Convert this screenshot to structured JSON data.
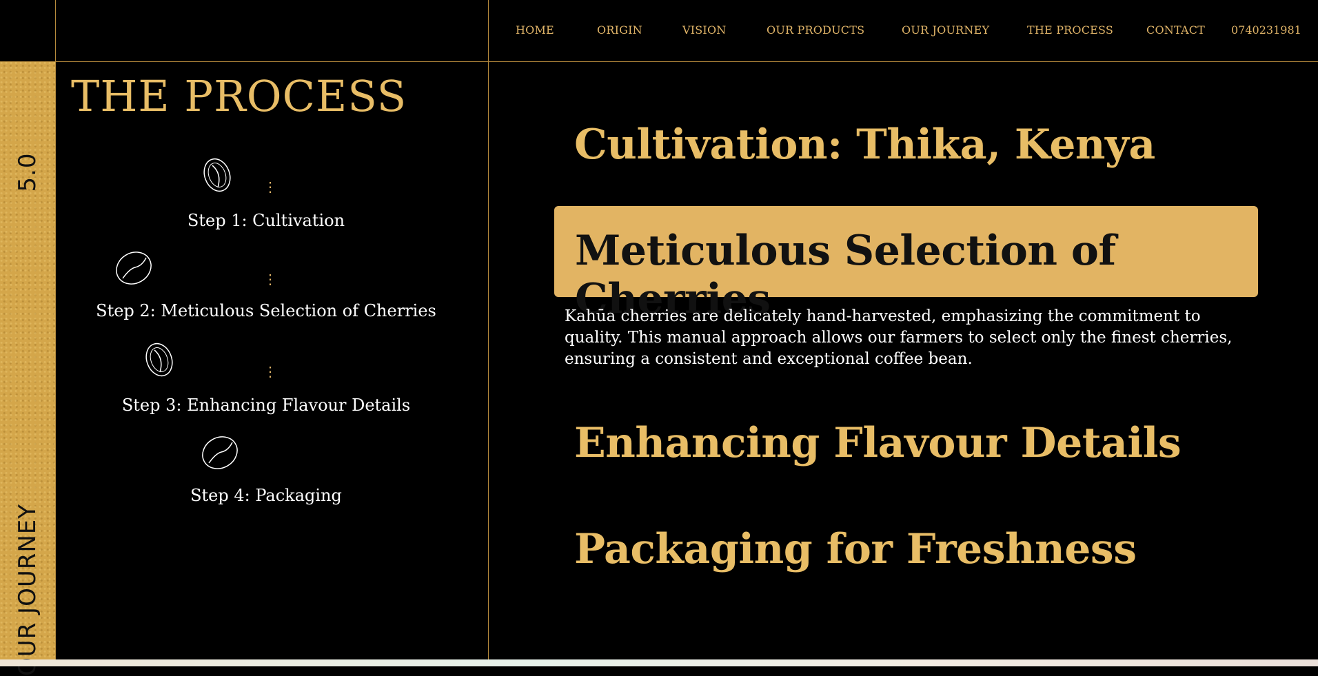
{
  "nav": {
    "items": [
      "HOME",
      "ORIGIN",
      "VISION",
      "OUR PRODUCTS",
      "OUR JOURNEY",
      "THE PROCESS",
      "CONTACT"
    ],
    "phone": "0740231981"
  },
  "sidebar": {
    "section_number": "5.0",
    "section_name": "OUR JOURNEY"
  },
  "page": {
    "title": "THE PROCESS"
  },
  "steps": [
    {
      "label": "Step 1: Cultivation",
      "icon": "coffee-bean-icon"
    },
    {
      "label": "Step 2: Meticulous Selection of Cherries",
      "icon": "coffee-bean-icon"
    },
    {
      "label": "Step 3: Enhancing Flavour Details",
      "icon": "coffee-bean-icon"
    },
    {
      "label": "Step 4: Packaging",
      "icon": "coffee-bean-icon"
    }
  ],
  "content": {
    "sections": [
      {
        "title": "Cultivation: Thika, Kenya"
      },
      {
        "title": "Meticulous Selection of Cherries",
        "description": "Kahūa cherries are delicately hand-harvested, emphasizing the commitment to quality. This manual approach allows our farmers to select only the finest cherries, ensuring a consistent and exceptional coffee bean."
      },
      {
        "title": "Enhancing Flavour Details"
      },
      {
        "title": "Packaging for Freshness"
      }
    ]
  },
  "colors": {
    "gold": "#e2b463",
    "background": "#000000",
    "line": "#b58a3c"
  }
}
